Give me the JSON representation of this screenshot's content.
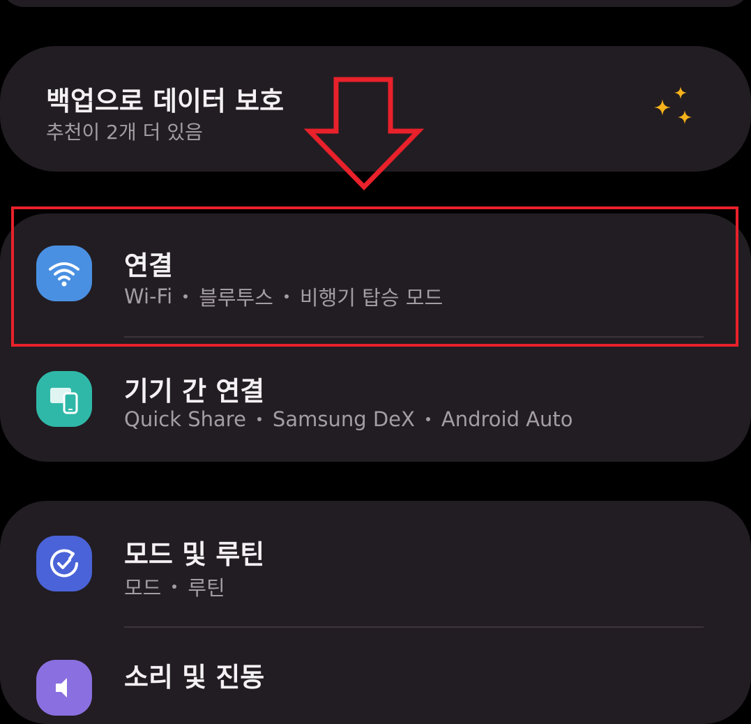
{
  "backup": {
    "title": "백업으로 데이터 보호",
    "subtitle": "추천이 2개 더 있음",
    "icon": "sparkle-icon"
  },
  "connections": {
    "title": "연결",
    "subtitle": [
      "Wi-Fi",
      "블루투스",
      "비행기 탑승 모드"
    ],
    "icon": "wifi-icon",
    "icon_color": "#4a90e2"
  },
  "device_connection": {
    "title": "기기 간 연결",
    "subtitle": [
      "Quick Share",
      "Samsung DeX",
      "Android Auto"
    ],
    "icon": "devices-icon",
    "icon_color": "#2fb8a8"
  },
  "modes_routines": {
    "title": "모드 및 루틴",
    "subtitle": [
      "모드",
      "루틴"
    ],
    "icon": "routine-check-icon",
    "icon_color": "#4a63d8"
  },
  "sound_vibration": {
    "title": "소리 및 진동",
    "icon": "sound-icon",
    "icon_color": "#8a6fe0"
  },
  "annotation": {
    "box_color": "#e8212b",
    "arrow_color": "#e8212b"
  },
  "colors": {
    "background": "#000000",
    "card": "#221d22",
    "sparkle": "#f6b21a"
  }
}
